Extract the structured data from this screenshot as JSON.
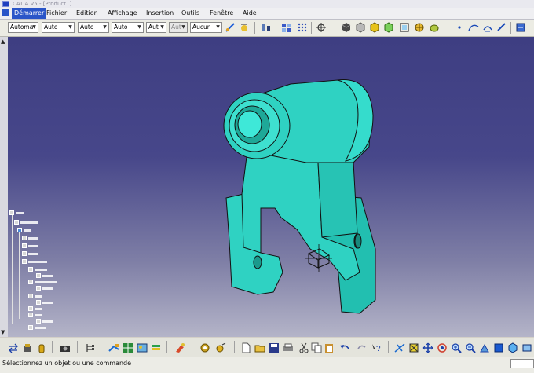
{
  "window": {
    "title": "CATIA V5 - [Product1]"
  },
  "menu": {
    "items": [
      "Démarrer",
      "Fichier",
      "Edition",
      "Affichage",
      "Insertion",
      "Outils",
      "Fenêtre",
      "Aide"
    ]
  },
  "format_toolbar": {
    "combos": [
      "Automa",
      "Auto",
      "Auto",
      "Auto",
      "Aut",
      "Aut",
      "Aucun"
    ]
  },
  "status": {
    "text": "Sélectionnez un objet ou une commande",
    "command_input": ""
  },
  "colors": {
    "part": "#2fd2c2",
    "part_dark": "#1aa89a",
    "background_top": "#3e3e82",
    "background_bottom": "#b4b4c8",
    "active_menu": "#2a55c8"
  },
  "icons": {
    "toolbar_top": [
      "new-sketch-icon",
      "ball-icon",
      "spring-icon",
      "multi-view-icon",
      "grid-icon",
      "compass-target-icon",
      "cube-dark-icon",
      "cube-silver-icon",
      "cube-yellow-icon",
      "cube-frame-icon",
      "globe-icon",
      "cube-green-icon",
      "dot-icon",
      "curve-icon",
      "arc-icon",
      "ruler-icon"
    ],
    "toolbar_bottom": [
      "swap-icon",
      "product-icon",
      "bottle-icon",
      "camera-icon",
      "tree-icon",
      "catalog-icon",
      "grid-image-icon",
      "stack-icon",
      "paint-icon",
      "gear-icon",
      "gear-gold-icon",
      "new-file-icon",
      "open-file-icon",
      "save-icon",
      "print-icon",
      "cut-icon",
      "copy-icon",
      "paste-icon",
      "undo-icon",
      "redo-icon",
      "help-icon",
      "fly-icon",
      "fit-all-icon",
      "pan-icon",
      "rotate-icon",
      "zoom-in-icon",
      "zoom-out-icon",
      "normal-view-icon",
      "iso-view-icon",
      "shading-icon"
    ]
  }
}
